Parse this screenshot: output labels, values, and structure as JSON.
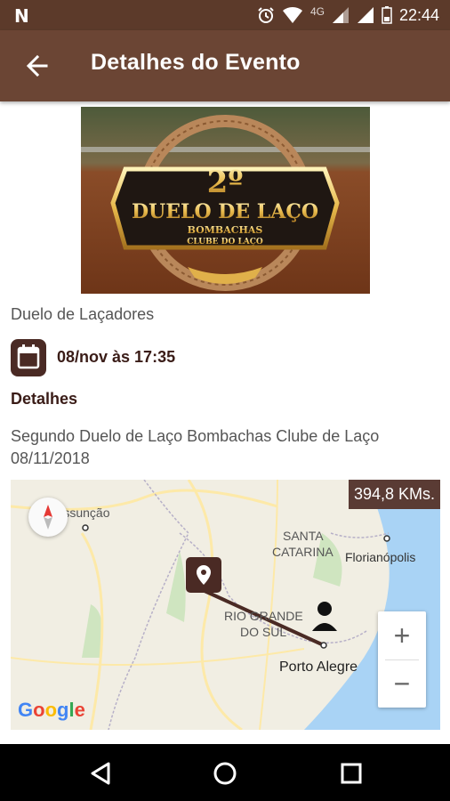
{
  "status": {
    "time": "22:44",
    "network": "4G",
    "left_icon": "n-icon",
    "icons": [
      "alarm-icon",
      "wifi-icon",
      "signal-icon",
      "signal-icon",
      "battery-icon"
    ]
  },
  "toolbar": {
    "title": "Detalhes do Evento",
    "back_icon": "arrow-left-icon"
  },
  "banner": {
    "line1": "2º",
    "line2": "DUELO DE LAÇO",
    "line3": "BOMBACHAS",
    "line4": "CLUBE DO LAÇO"
  },
  "event": {
    "name": "Duelo de Laçadores",
    "date": "08/nov às 17:35",
    "details_heading": "Detalhes",
    "description": "Segundo Duelo de Laço Bombachas Clube de Laço 08/11/2018"
  },
  "map": {
    "distance": "394,8 KMs.",
    "labels": {
      "asuncion": "Assunção",
      "santa_catarina_1": "SANTA",
      "santa_catarina_2": "CATARINA",
      "florianopolis": "Florianópolis",
      "rio_grande_1": "RIO GRANDE",
      "rio_grande_2": "DO SUL",
      "porto_alegre": "Porto Alegre"
    },
    "zoom_in": "+",
    "zoom_out": "−",
    "google": "Google"
  },
  "colors": {
    "statusbar": "#5c3a2a",
    "toolbar": "#6b4534",
    "accent_dark": "#4a2a24",
    "distance_badge": "#5a3b34"
  }
}
